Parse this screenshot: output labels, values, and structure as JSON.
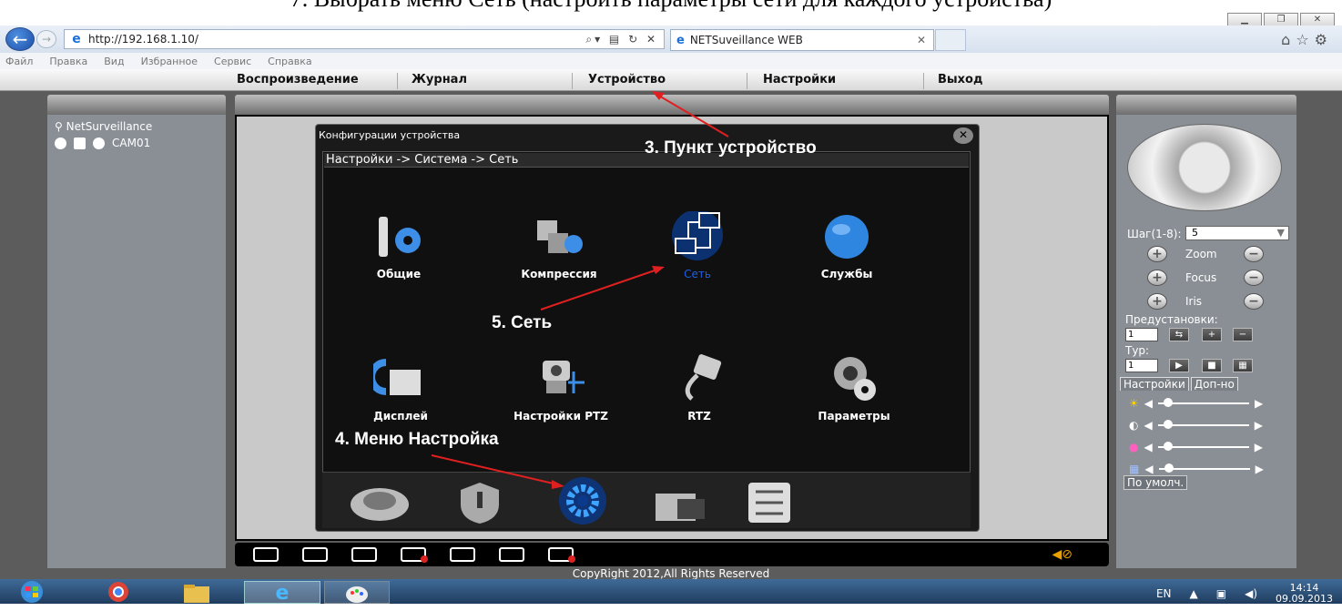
{
  "caption": "7. Выбрать меню Сеть (настроить параметры сети для каждого устройства)",
  "browser": {
    "url": "http://192.168.1.10/",
    "tab_title": "NETSuveillance WEB",
    "menu": [
      "Файл",
      "Правка",
      "Вид",
      "Избранное",
      "Сервис",
      "Справка"
    ]
  },
  "nav": [
    "Воспроизведение",
    "Журнал",
    "Устройство",
    "Настройки",
    "Выход"
  ],
  "left": {
    "root": "NetSurveillance",
    "camera": "CAM01"
  },
  "dialog": {
    "title": "Конфигурации устройства",
    "breadcrumb": "Настройки -> Система -> Сеть",
    "items": [
      "Общие",
      "Компрессия",
      "Сеть",
      "Службы",
      "Дисплей",
      "Настройки PTZ",
      "RTZ",
      "Параметры"
    ]
  },
  "annotations": {
    "a3": "3. Пункт устройство",
    "a5": "5. Сеть",
    "a4": "4. Меню Настройка"
  },
  "right": {
    "step_label": "Шаг(1-8):",
    "step_value": "5",
    "zoom": "Zoom",
    "focus": "Focus",
    "iris": "Iris",
    "presets_label": "Предустановки:",
    "preset_value": "1",
    "tour_label": "Тур:",
    "tour_value": "1",
    "tab_settings": "Настройки",
    "tab_extra": "Доп-но",
    "default_button": "По умолч."
  },
  "footer": "CopyRight 2012,All Rights Reserved",
  "tray": {
    "lang": "EN",
    "time": "14:14",
    "date": "09.09.2013"
  },
  "colors": {
    "selected_item": "#1e5ee8",
    "annotation_arrow": "#e02020"
  }
}
